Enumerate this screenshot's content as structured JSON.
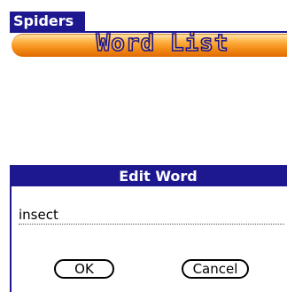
{
  "app": {
    "title": "Spiders"
  },
  "banner": {
    "title": "Word List"
  },
  "dialog": {
    "title": "Edit Word",
    "word_value": "insect",
    "ok_label": "OK",
    "cancel_label": "Cancel"
  },
  "colors": {
    "title_bar": "#1e1890",
    "banner_orange": "#f5901a",
    "background": "#ffffff"
  }
}
